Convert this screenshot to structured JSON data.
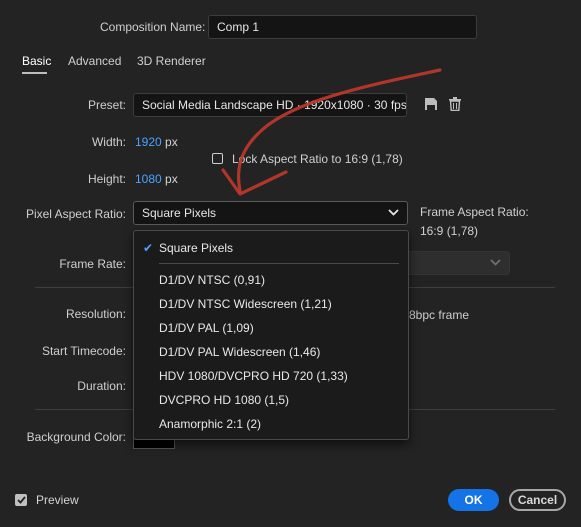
{
  "composition": {
    "name_label": "Composition Name:",
    "name_value": "Comp 1"
  },
  "tabs": [
    {
      "label": "Basic"
    },
    {
      "label": "Advanced"
    },
    {
      "label": "3D Renderer"
    }
  ],
  "preset": {
    "label": "Preset:",
    "value": "Social Media Landscape HD  ·  1920x1080 · 30 fps"
  },
  "width": {
    "label": "Width:",
    "value": "1920",
    "unit": "px"
  },
  "height": {
    "label": "Height:",
    "value": "1080",
    "unit": "px"
  },
  "lock_aspect": {
    "label": "Lock Aspect Ratio to 16:9 (1,78)",
    "checked": false
  },
  "pixel_aspect": {
    "label": "Pixel Aspect Ratio:",
    "value": "Square Pixels"
  },
  "frame_aspect": {
    "label": "Frame Aspect Ratio:",
    "value": "16:9 (1,78)"
  },
  "frame_rate": {
    "label": "Frame Rate:"
  },
  "resolution": {
    "label": "Resolution:",
    "info": "8bpc frame"
  },
  "start_timecode": {
    "label": "Start Timecode:"
  },
  "duration": {
    "label": "Duration:"
  },
  "background": {
    "label": "Background Color:",
    "color": "#000000"
  },
  "dropdown": {
    "items": [
      {
        "label": "Square Pixels",
        "selected": true
      },
      {
        "label": "D1/DV NTSC (0,91)"
      },
      {
        "label": "D1/DV NTSC Widescreen (1,21)"
      },
      {
        "label": "D1/DV PAL (1,09)"
      },
      {
        "label": "D1/DV PAL Widescreen (1,46)"
      },
      {
        "label": "HDV 1080/DVCPRO HD 720 (1,33)"
      },
      {
        "label": "DVCPRO HD 1080 (1,5)"
      },
      {
        "label": "Anamorphic 2:1 (2)"
      }
    ]
  },
  "footer": {
    "preview_label": "Preview",
    "preview_checked": true,
    "ok_label": "OK",
    "cancel_label": "Cancel"
  },
  "colors": {
    "accent": "#1473e6",
    "value_blue": "#4aa3ff",
    "annotation_arrow": "#c0392b"
  },
  "icons": [
    "chevron-down-icon",
    "save-preset-icon",
    "trash-icon",
    "checkmark-icon",
    "checkbox-icon",
    "hand-drawn-arrow"
  ]
}
